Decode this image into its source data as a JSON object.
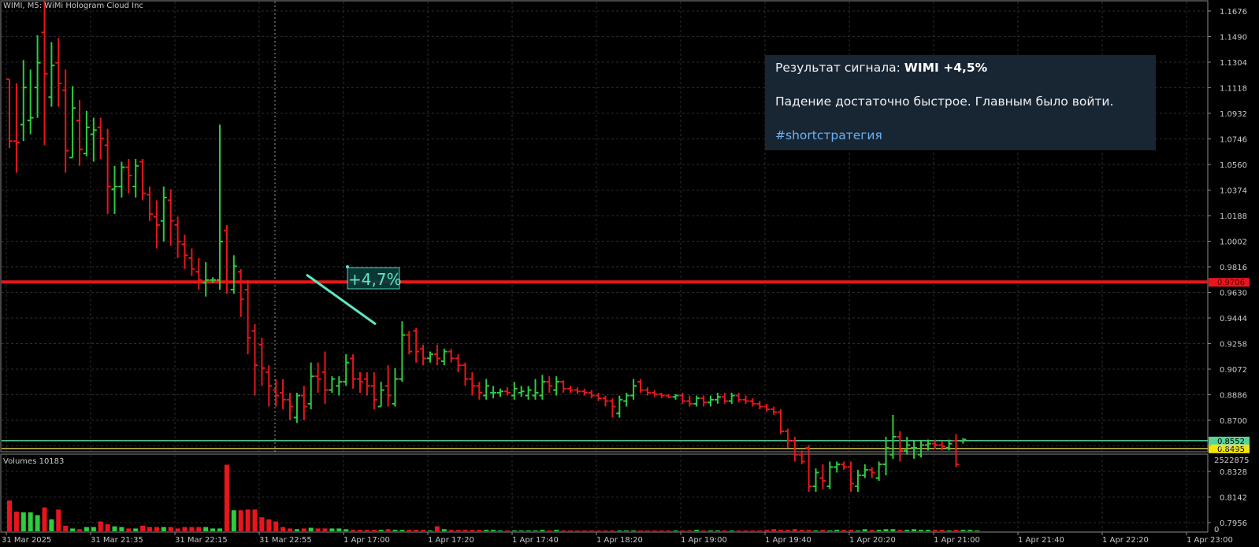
{
  "chart_title": "WIMI, M5:  WiMi Hologram Cloud Inc",
  "volume_title": "Volumes 10183",
  "signal": {
    "prefix": "Результат сигнала: ",
    "ticker_result": "WIMI +4,5%",
    "comment": "Падение достаточно быстрое. Главным было войти.",
    "hashtag": "#shortстратегия"
  },
  "annotation": {
    "label": "+4,7%"
  },
  "colors": {
    "background": "#000000",
    "grid": "#2b2b2b",
    "up_bar": "#2ecc40",
    "down_bar": "#e8161c",
    "resistance_line": "#e8161c",
    "support_line_green": "#57d49a",
    "support_line_yellow": "#c9c24a",
    "annotation": "#5ee8c3",
    "panel_bg": "#182533",
    "hashtag": "#6ab2f2"
  },
  "chart_data": {
    "type": "ohlc",
    "price_axis": {
      "ylim": [
        0.78,
        1.175
      ],
      "tick_labels": [
        "1.1676",
        "1.1490",
        "1.1304",
        "1.1118",
        "1.0932",
        "1.0746",
        "1.0560",
        "1.0374",
        "1.0188",
        "1.0002",
        "0.9816",
        "0.9630",
        "0.9444",
        "0.9258",
        "0.9072",
        "0.8886",
        "0.8700",
        "0.8514",
        "0.8328",
        "0.8142",
        "0.7956"
      ]
    },
    "time_axis_labels": [
      "31 Mar 2025",
      "31 Mar 21:35",
      "31 Mar 22:15",
      "31 Mar 22:55",
      "1 Apr 17:00",
      "1 Apr 17:20",
      "1 Apr 17:40",
      "1 Apr 18:20",
      "1 Apr 19:00",
      "1 Apr 19:40",
      "1 Apr 20:20",
      "1 Apr 21:00",
      "1 Apr 21:40",
      "1 Apr 22:20",
      "1 Apr 23:00"
    ],
    "horizontal_lines": [
      {
        "value": 0.9706,
        "label": "0.9706",
        "color": "#e8161c"
      },
      {
        "value": 0.8552,
        "label": "0.8552",
        "color": "#57d49a"
      },
      {
        "value": 0.8495,
        "label": "0.8495",
        "color": "#c9c24a"
      }
    ],
    "bars": [
      {
        "o": 1.118,
        "h": 1.118,
        "l": 1.068,
        "c": 1.073
      },
      {
        "o": 1.073,
        "h": 1.115,
        "l": 1.05,
        "c": 1.072
      },
      {
        "o": 1.085,
        "h": 1.132,
        "l": 1.073,
        "c": 1.112
      },
      {
        "o": 1.088,
        "h": 1.125,
        "l": 1.078,
        "c": 1.09
      },
      {
        "o": 1.112,
        "h": 1.15,
        "l": 1.09,
        "c": 1.13
      },
      {
        "o": 1.152,
        "h": 1.175,
        "l": 1.07,
        "c": 1.122
      },
      {
        "o": 1.105,
        "h": 1.145,
        "l": 1.098,
        "c": 1.128
      },
      {
        "o": 1.13,
        "h": 1.148,
        "l": 1.098,
        "c": 1.115
      },
      {
        "o": 1.11,
        "h": 1.125,
        "l": 1.05,
        "c": 1.066
      },
      {
        "o": 1.061,
        "h": 1.113,
        "l": 1.061,
        "c": 1.097
      },
      {
        "o": 1.088,
        "h": 1.103,
        "l": 1.055,
        "c": 1.067
      },
      {
        "o": 1.064,
        "h": 1.095,
        "l": 1.062,
        "c": 1.083
      },
      {
        "o": 1.078,
        "h": 1.09,
        "l": 1.058,
        "c": 1.081
      },
      {
        "o": 1.083,
        "h": 1.09,
        "l": 1.06,
        "c": 1.075
      },
      {
        "o": 1.07,
        "h": 1.082,
        "l": 1.02,
        "c": 1.04
      },
      {
        "o": 1.038,
        "h": 1.055,
        "l": 1.02,
        "c": 1.04
      },
      {
        "o": 1.04,
        "h": 1.058,
        "l": 1.032,
        "c": 1.054
      },
      {
        "o": 1.054,
        "h": 1.06,
        "l": 1.035,
        "c": 1.048
      },
      {
        "o": 1.04,
        "h": 1.06,
        "l": 1.032,
        "c": 1.055
      },
      {
        "o": 1.058,
        "h": 1.06,
        "l": 1.03,
        "c": 1.035
      },
      {
        "o": 1.034,
        "h": 1.04,
        "l": 1.015,
        "c": 1.02
      },
      {
        "o": 1.018,
        "h": 1.03,
        "l": 0.995,
        "c": 1.012
      },
      {
        "o": 1.015,
        "h": 1.04,
        "l": 1.0,
        "c": 1.032
      },
      {
        "o": 1.03,
        "h": 1.038,
        "l": 0.997,
        "c": 1.015
      },
      {
        "o": 1.012,
        "h": 1.018,
        "l": 0.988,
        "c": 1.0
      },
      {
        "o": 0.998,
        "h": 1.005,
        "l": 0.98,
        "c": 0.99
      },
      {
        "o": 0.988,
        "h": 0.995,
        "l": 0.975,
        "c": 0.98
      },
      {
        "o": 0.978,
        "h": 0.988,
        "l": 0.965,
        "c": 0.972
      },
      {
        "o": 0.97,
        "h": 0.985,
        "l": 0.96,
        "c": 0.972
      },
      {
        "o": 0.972,
        "h": 0.974,
        "l": 0.97,
        "c": 0.972
      },
      {
        "o": 0.972,
        "h": 1.085,
        "l": 0.965,
        "c": 1.0
      },
      {
        "o": 1.008,
        "h": 1.012,
        "l": 0.962,
        "c": 0.97
      },
      {
        "o": 0.965,
        "h": 0.99,
        "l": 0.962,
        "c": 0.982
      },
      {
        "o": 0.978,
        "h": 0.98,
        "l": 0.945,
        "c": 0.958
      },
      {
        "o": 0.965,
        "h": 0.972,
        "l": 0.918,
        "c": 0.93
      },
      {
        "o": 0.935,
        "h": 0.94,
        "l": 0.888,
        "c": 0.91
      },
      {
        "o": 0.925,
        "h": 0.93,
        "l": 0.895,
        "c": 0.908
      },
      {
        "o": 0.905,
        "h": 0.91,
        "l": 0.88,
        "c": 0.895
      },
      {
        "o": 0.892,
        "h": 0.9,
        "l": 0.88,
        "c": 0.888
      },
      {
        "o": 0.89,
        "h": 0.9,
        "l": 0.878,
        "c": 0.885
      },
      {
        "o": 0.885,
        "h": 0.89,
        "l": 0.87,
        "c": 0.88
      },
      {
        "o": 0.872,
        "h": 0.89,
        "l": 0.868,
        "c": 0.888
      },
      {
        "o": 0.888,
        "h": 0.895,
        "l": 0.87,
        "c": 0.88
      },
      {
        "o": 0.882,
        "h": 0.912,
        "l": 0.878,
        "c": 0.902
      },
      {
        "o": 0.902,
        "h": 0.912,
        "l": 0.89,
        "c": 0.9
      },
      {
        "o": 0.905,
        "h": 0.92,
        "l": 0.882,
        "c": 0.892
      },
      {
        "o": 0.892,
        "h": 0.902,
        "l": 0.89,
        "c": 0.9
      },
      {
        "o": 0.895,
        "h": 0.902,
        "l": 0.888,
        "c": 0.898
      },
      {
        "o": 0.898,
        "h": 0.918,
        "l": 0.895,
        "c": 0.912
      },
      {
        "o": 0.915,
        "h": 0.918,
        "l": 0.893,
        "c": 0.9
      },
      {
        "o": 0.9,
        "h": 0.905,
        "l": 0.89,
        "c": 0.898
      },
      {
        "o": 0.9,
        "h": 0.905,
        "l": 0.888,
        "c": 0.895
      },
      {
        "o": 0.895,
        "h": 0.905,
        "l": 0.878,
        "c": 0.885
      },
      {
        "o": 0.88,
        "h": 0.898,
        "l": 0.88,
        "c": 0.892
      },
      {
        "o": 0.895,
        "h": 0.91,
        "l": 0.88,
        "c": 0.888
      },
      {
        "o": 0.882,
        "h": 0.908,
        "l": 0.88,
        "c": 0.9
      },
      {
        "o": 0.9,
        "h": 0.942,
        "l": 0.898,
        "c": 0.932
      },
      {
        "o": 0.932,
        "h": 0.935,
        "l": 0.918,
        "c": 0.92
      },
      {
        "o": 0.935,
        "h": 0.937,
        "l": 0.912,
        "c": 0.92
      },
      {
        "o": 0.922,
        "h": 0.925,
        "l": 0.91,
        "c": 0.915
      },
      {
        "o": 0.915,
        "h": 0.92,
        "l": 0.912,
        "c": 0.918
      },
      {
        "o": 0.918,
        "h": 0.925,
        "l": 0.91,
        "c": 0.915
      },
      {
        "o": 0.913,
        "h": 0.922,
        "l": 0.91,
        "c": 0.92
      },
      {
        "o": 0.92,
        "h": 0.922,
        "l": 0.912,
        "c": 0.915
      },
      {
        "o": 0.915,
        "h": 0.918,
        "l": 0.905,
        "c": 0.91
      },
      {
        "o": 0.91,
        "h": 0.912,
        "l": 0.895,
        "c": 0.9
      },
      {
        "o": 0.9,
        "h": 0.905,
        "l": 0.888,
        "c": 0.895
      },
      {
        "o": 0.895,
        "h": 0.898,
        "l": 0.885,
        "c": 0.89
      },
      {
        "o": 0.888,
        "h": 0.9,
        "l": 0.885,
        "c": 0.895
      },
      {
        "o": 0.89,
        "h": 0.895,
        "l": 0.886,
        "c": 0.89
      },
      {
        "o": 0.89,
        "h": 0.893,
        "l": 0.887,
        "c": 0.891
      },
      {
        "o": 0.891,
        "h": 0.894,
        "l": 0.888,
        "c": 0.89
      },
      {
        "o": 0.888,
        "h": 0.898,
        "l": 0.885,
        "c": 0.893
      },
      {
        "o": 0.89,
        "h": 0.895,
        "l": 0.887,
        "c": 0.891
      },
      {
        "o": 0.888,
        "h": 0.895,
        "l": 0.885,
        "c": 0.892
      },
      {
        "o": 0.888,
        "h": 0.9,
        "l": 0.885,
        "c": 0.89
      },
      {
        "o": 0.888,
        "h": 0.903,
        "l": 0.885,
        "c": 0.898
      },
      {
        "o": 0.898,
        "h": 0.902,
        "l": 0.89,
        "c": 0.895
      },
      {
        "o": 0.892,
        "h": 0.902,
        "l": 0.888,
        "c": 0.898
      },
      {
        "o": 0.898,
        "h": 0.899,
        "l": 0.89,
        "c": 0.893
      },
      {
        "o": 0.893,
        "h": 0.895,
        "l": 0.89,
        "c": 0.892
      },
      {
        "o": 0.892,
        "h": 0.894,
        "l": 0.889,
        "c": 0.891
      },
      {
        "o": 0.891,
        "h": 0.893,
        "l": 0.888,
        "c": 0.89
      },
      {
        "o": 0.89,
        "h": 0.892,
        "l": 0.886,
        "c": 0.888
      },
      {
        "o": 0.888,
        "h": 0.89,
        "l": 0.884,
        "c": 0.886
      },
      {
        "o": 0.886,
        "h": 0.888,
        "l": 0.88,
        "c": 0.884
      },
      {
        "o": 0.884,
        "h": 0.886,
        "l": 0.872,
        "c": 0.88
      },
      {
        "o": 0.875,
        "h": 0.888,
        "l": 0.872,
        "c": 0.885
      },
      {
        "o": 0.884,
        "h": 0.89,
        "l": 0.88,
        "c": 0.888
      },
      {
        "o": 0.888,
        "h": 0.9,
        "l": 0.885,
        "c": 0.895
      },
      {
        "o": 0.898,
        "h": 0.9,
        "l": 0.89,
        "c": 0.892
      },
      {
        "o": 0.892,
        "h": 0.894,
        "l": 0.888,
        "c": 0.89
      },
      {
        "o": 0.89,
        "h": 0.892,
        "l": 0.887,
        "c": 0.889
      },
      {
        "o": 0.889,
        "h": 0.89,
        "l": 0.886,
        "c": 0.888
      },
      {
        "o": 0.888,
        "h": 0.889,
        "l": 0.886,
        "c": 0.887
      },
      {
        "o": 0.887,
        "h": 0.889,
        "l": 0.885,
        "c": 0.888
      },
      {
        "o": 0.888,
        "h": 0.89,
        "l": 0.882,
        "c": 0.884
      },
      {
        "o": 0.884,
        "h": 0.888,
        "l": 0.88,
        "c": 0.882
      },
      {
        "o": 0.882,
        "h": 0.888,
        "l": 0.88,
        "c": 0.886
      },
      {
        "o": 0.886,
        "h": 0.888,
        "l": 0.88,
        "c": 0.883
      },
      {
        "o": 0.883,
        "h": 0.888,
        "l": 0.88,
        "c": 0.885
      },
      {
        "o": 0.885,
        "h": 0.89,
        "l": 0.882,
        "c": 0.887
      },
      {
        "o": 0.887,
        "h": 0.89,
        "l": 0.882,
        "c": 0.884
      },
      {
        "o": 0.884,
        "h": 0.89,
        "l": 0.882,
        "c": 0.888
      },
      {
        "o": 0.888,
        "h": 0.89,
        "l": 0.883,
        "c": 0.885
      },
      {
        "o": 0.885,
        "h": 0.888,
        "l": 0.882,
        "c": 0.884
      },
      {
        "o": 0.884,
        "h": 0.886,
        "l": 0.88,
        "c": 0.882
      },
      {
        "o": 0.882,
        "h": 0.884,
        "l": 0.878,
        "c": 0.88
      },
      {
        "o": 0.88,
        "h": 0.882,
        "l": 0.876,
        "c": 0.878
      },
      {
        "o": 0.878,
        "h": 0.88,
        "l": 0.874,
        "c": 0.876
      },
      {
        "o": 0.876,
        "h": 0.878,
        "l": 0.86,
        "c": 0.862
      },
      {
        "o": 0.862,
        "h": 0.864,
        "l": 0.85,
        "c": 0.855
      },
      {
        "o": 0.855,
        "h": 0.858,
        "l": 0.84,
        "c": 0.845
      },
      {
        "o": 0.845,
        "h": 0.848,
        "l": 0.838,
        "c": 0.84
      },
      {
        "o": 0.85,
        "h": 0.852,
        "l": 0.818,
        "c": 0.822
      },
      {
        "o": 0.822,
        "h": 0.835,
        "l": 0.818,
        "c": 0.832
      },
      {
        "o": 0.828,
        "h": 0.838,
        "l": 0.82,
        "c": 0.826
      },
      {
        "o": 0.822,
        "h": 0.84,
        "l": 0.82,
        "c": 0.836
      },
      {
        "o": 0.836,
        "h": 0.84,
        "l": 0.832,
        "c": 0.838
      },
      {
        "o": 0.838,
        "h": 0.84,
        "l": 0.834,
        "c": 0.836
      },
      {
        "o": 0.836,
        "h": 0.84,
        "l": 0.818,
        "c": 0.824
      },
      {
        "o": 0.822,
        "h": 0.834,
        "l": 0.818,
        "c": 0.83
      },
      {
        "o": 0.83,
        "h": 0.838,
        "l": 0.828,
        "c": 0.834
      },
      {
        "o": 0.834,
        "h": 0.836,
        "l": 0.828,
        "c": 0.832
      },
      {
        "o": 0.828,
        "h": 0.84,
        "l": 0.826,
        "c": 0.838
      },
      {
        "o": 0.838,
        "h": 0.858,
        "l": 0.83,
        "c": 0.85
      },
      {
        "o": 0.845,
        "h": 0.874,
        "l": 0.842,
        "c": 0.858
      },
      {
        "o": 0.858,
        "h": 0.862,
        "l": 0.84,
        "c": 0.848
      },
      {
        "o": 0.848,
        "h": 0.858,
        "l": 0.845,
        "c": 0.852
      },
      {
        "o": 0.85,
        "h": 0.855,
        "l": 0.842,
        "c": 0.85
      },
      {
        "o": 0.845,
        "h": 0.855,
        "l": 0.843,
        "c": 0.852
      },
      {
        "o": 0.852,
        "h": 0.856,
        "l": 0.848,
        "c": 0.853
      },
      {
        "o": 0.853,
        "h": 0.856,
        "l": 0.849,
        "c": 0.852
      },
      {
        "o": 0.852,
        "h": 0.855,
        "l": 0.848,
        "c": 0.851
      },
      {
        "o": 0.85,
        "h": 0.856,
        "l": 0.848,
        "c": 0.853
      },
      {
        "o": 0.855,
        "h": 0.86,
        "l": 0.836,
        "c": 0.838
      },
      {
        "o": 0.855,
        "h": 0.857,
        "l": 0.853,
        "c": 0.856
      }
    ],
    "volume_axis": {
      "max": 2522875,
      "tick_labels": [
        "2522875",
        "0"
      ]
    },
    "volumes": [
      0.44,
      0.28,
      0.27,
      0.27,
      0.23,
      0.34,
      0.17,
      0.31,
      0.08,
      0.04,
      0.03,
      0.06,
      0.06,
      0.14,
      0.1,
      0.07,
      0.06,
      0.04,
      0.04,
      0.08,
      0.06,
      0.06,
      0.06,
      0.06,
      0.04,
      0.06,
      0.06,
      0.06,
      0.06,
      0.04,
      0.04,
      0.95,
      0.3,
      0.3,
      0.31,
      0.31,
      0.2,
      0.17,
      0.14,
      0.06,
      0.04,
      0.03,
      0.04,
      0.05,
      0.04,
      0.04,
      0.04,
      0.04,
      0.03,
      0.02,
      0.02,
      0.02,
      0.02,
      0.02,
      0.03,
      0.02,
      0.02,
      0.02,
      0.02,
      0.02,
      0.01,
      0.07,
      0.03,
      0.02,
      0.02,
      0.02,
      0.02,
      0.02,
      0.02,
      0.02,
      0.01,
      0.01,
      0.01,
      0.01,
      0.01,
      0.01,
      0.02,
      0.01,
      0.02,
      0.01,
      0.01,
      0.01,
      0.01,
      0.01,
      0.01,
      0.01,
      0.01,
      0.01,
      0.01,
      0.01,
      0.01,
      0.01,
      0.01,
      0.01,
      0.01,
      0.01,
      0.01,
      0.01,
      0.02,
      0.01,
      0.01,
      0.01,
      0.01,
      0.01,
      0.01,
      0.01,
      0.01,
      0.01,
      0.02,
      0.03,
      0.02,
      0.02,
      0.03,
      0.02,
      0.02,
      0.01,
      0.02,
      0.01,
      0.02,
      0.02,
      0.02,
      0.01,
      0.03,
      0.02,
      0.02,
      0.03,
      0.03,
      0.02,
      0.02,
      0.03,
      0.02,
      0.02,
      0.02,
      0.02,
      0.01,
      0.02,
      0.02,
      0.02,
      0.01
    ]
  }
}
